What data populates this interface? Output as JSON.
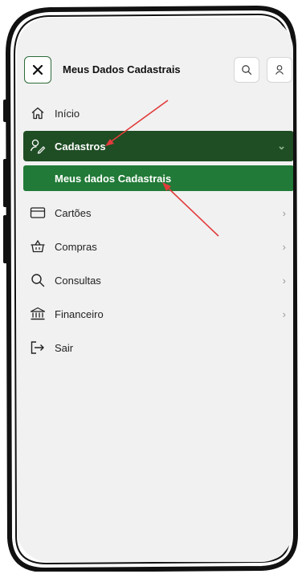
{
  "header": {
    "title": "Meus Dados Cadastrais"
  },
  "menu": {
    "items": [
      {
        "label": "Início",
        "icon": "home-icon"
      },
      {
        "label": "Cadastros",
        "icon": "user-edit-icon",
        "chevron": "⌄"
      },
      {
        "label": "Meus dados Cadastrais"
      },
      {
        "label": "Cartões",
        "icon": "card-icon",
        "chevron": "›"
      },
      {
        "label": "Compras",
        "icon": "basket-icon",
        "chevron": "›"
      },
      {
        "label": "Consultas",
        "icon": "search-icon",
        "chevron": "›"
      },
      {
        "label": "Financeiro",
        "icon": "bank-icon",
        "chevron": "›"
      },
      {
        "label": "Sair",
        "icon": "logout-icon"
      }
    ]
  },
  "colors": {
    "active_bg": "#1f4d24",
    "submenu_bg": "#217a37",
    "annotation_arrow": "#e23b3b"
  }
}
